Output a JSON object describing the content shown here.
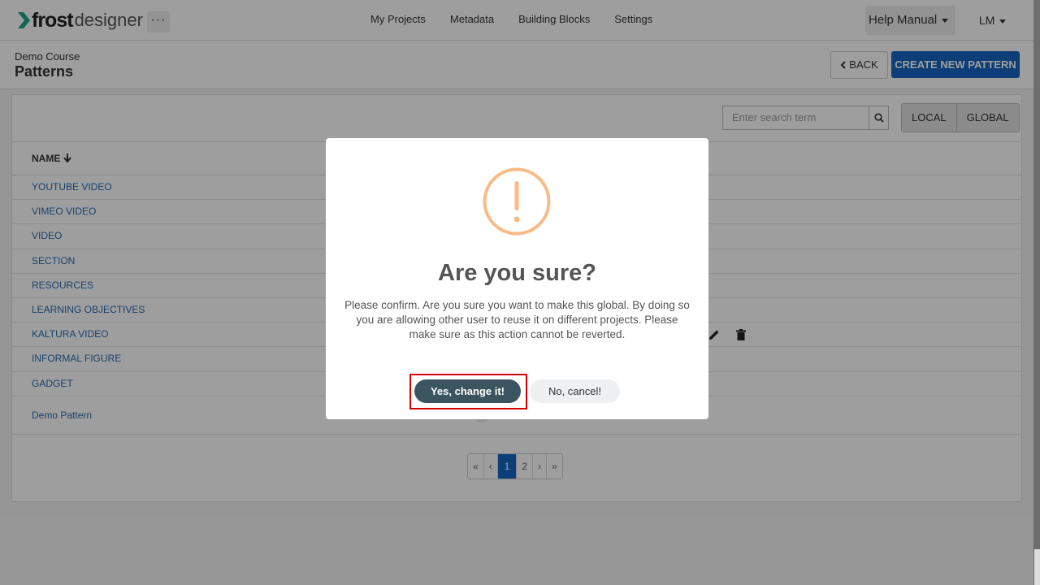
{
  "app": {
    "brand_bold": "frost",
    "brand_light": "designer",
    "more_label": "···"
  },
  "nav": {
    "links": [
      "My Projects",
      "Metadata",
      "Building Blocks",
      "Settings"
    ],
    "help_label": "Help Manual",
    "user_label": "LM"
  },
  "header": {
    "breadcrumb": "Demo Course",
    "title": "Patterns",
    "back_label": "BACK",
    "create_label": "CREATE NEW PATTERN"
  },
  "search": {
    "placeholder": "Enter search term"
  },
  "scope_toggle": {
    "local_label": "LOCAL",
    "global_label": "GLOBAL"
  },
  "table": {
    "name_header": "NAME",
    "rows": [
      "YOUTUBE VIDEO",
      "VIMEO VIDEO",
      "VIDEO",
      "SECTION",
      "RESOURCES",
      "LEARNING OBJECTIVES",
      "KALTURA VIDEO",
      "INFORMAL FIGURE",
      "GADGET",
      "Demo Pattern"
    ]
  },
  "pagination": {
    "first": "«",
    "prev": "‹",
    "pages": [
      "1",
      "2"
    ],
    "current": "1",
    "next": "›",
    "last": "»"
  },
  "dialog": {
    "title": "Are you sure?",
    "message": "Please confirm. Are you sure you want to make this global. By doing so you are allowing other user to reuse it on different projects. Please make sure as this action cannot be reverted.",
    "confirm_label": "Yes, change it!",
    "cancel_label": "No, cancel!"
  },
  "colors": {
    "brand_green": "#1aa985",
    "primary": "#1665c1",
    "warning": "#f8bb86",
    "confirm_bg": "#3b5560",
    "highlight": "#d50000"
  },
  "icons": [
    "chevron-logo-icon",
    "search-icon",
    "arrow-down-icon",
    "caret-down-icon",
    "chevron-left-icon",
    "pencil-icon",
    "trash-icon",
    "warning-icon"
  ]
}
